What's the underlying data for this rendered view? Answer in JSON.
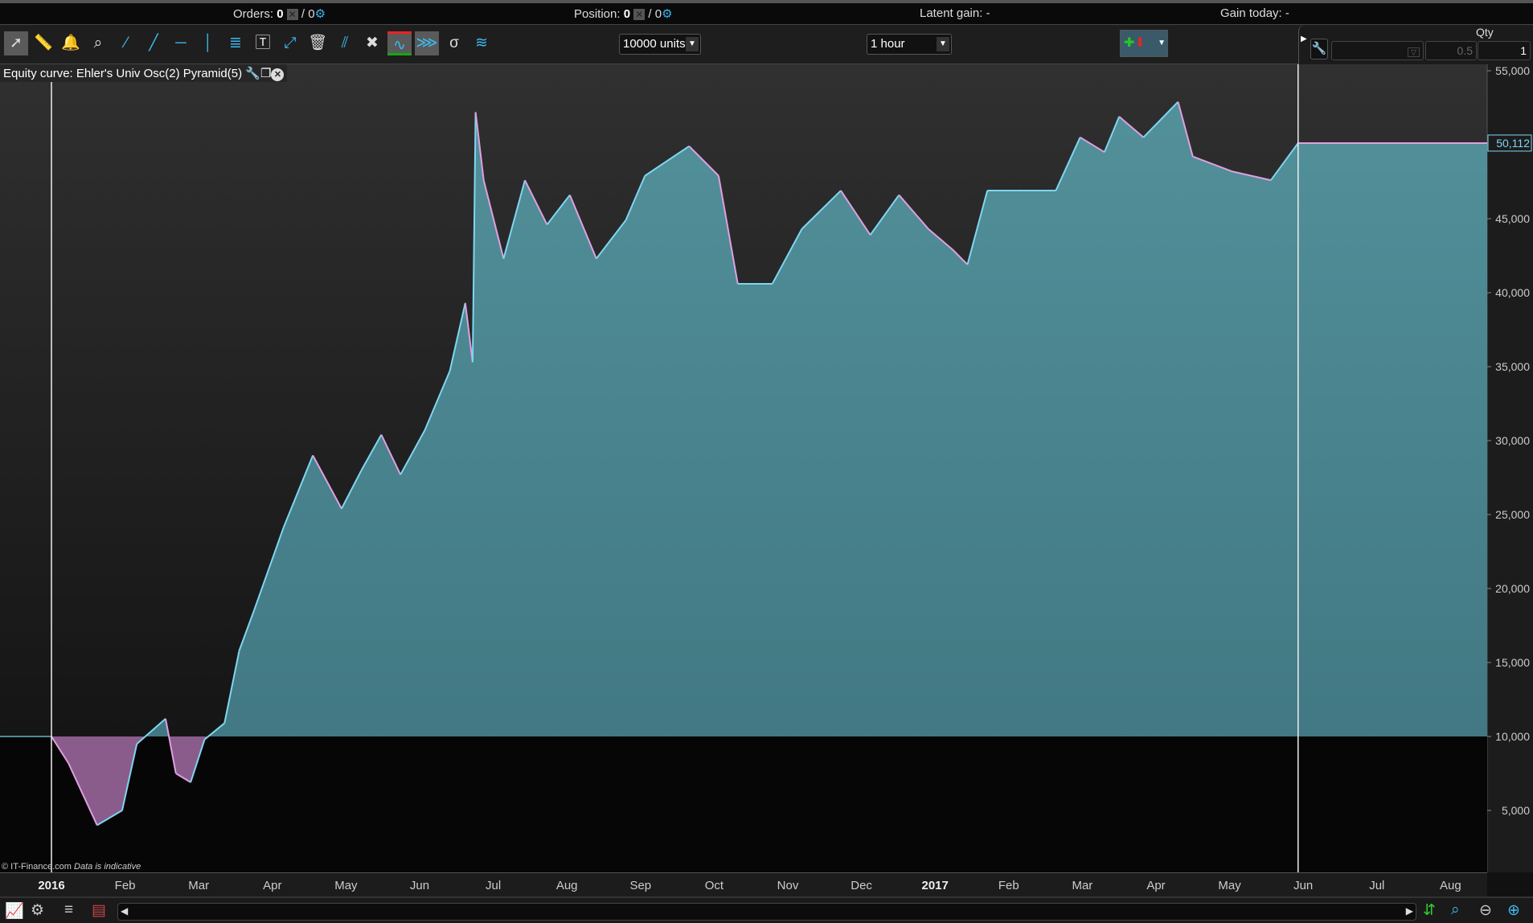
{
  "status": {
    "orders_label": "Orders:",
    "orders_value": "0",
    "orders_total": "/ 0",
    "position_label": "Position:",
    "position_value": "0",
    "position_total": "/ 0",
    "latent_gain": "Latent gain: -",
    "gain_today": "Gain today: -"
  },
  "toolbar": {
    "icons": [
      "cursor-icon",
      "ruler-icon",
      "alert-bell-icon",
      "zoom-icon",
      "segment-icon",
      "line-icon",
      "horizontal-line-icon",
      "vertical-line-icon",
      "fibonacci-icon",
      "text-icon",
      "point-icon",
      "trash-icon",
      "parallel-icon",
      "tools-icon",
      "channel-icon",
      "triangle-channel-icon",
      "std-dev-icon",
      "regression-icon"
    ],
    "units_value": "10000 units",
    "timeframe_value": "1 hour",
    "qty_label": "Qty",
    "qty_step": "0.5",
    "qty_value": "1"
  },
  "chart": {
    "legend": "Equity curve: Ehler's Univ Osc(2) Pyramid(5)",
    "copyright": "© IT-Finance.com",
    "disclaimer": "Data is indicative",
    "last_value_label": "50,112"
  },
  "colors": {
    "fill_positive": "#4d8b96",
    "fill_negative": "#8a5c8c",
    "line": "#7fd6f2",
    "line_down": "#e0a0e0",
    "background": "#2a2a2a"
  },
  "chart_data": {
    "type": "area",
    "title": "Equity curve: Ehler's Univ Osc(2) Pyramid(5)",
    "xlabel": "",
    "ylabel": "",
    "x_unit": "months since Jan 2016",
    "baseline": 10000,
    "last_value": 50112,
    "ylim": [
      1000,
      55500
    ],
    "xlim": [
      -0.7,
      19.5
    ],
    "y_ticks": [
      5000,
      10000,
      15000,
      20000,
      25000,
      30000,
      35000,
      40000,
      45000,
      50000,
      55000
    ],
    "y_tick_labels": [
      "5,000",
      "10,000",
      "15,000",
      "20,000",
      "25,000",
      "30,000",
      "35,000",
      "40,000",
      "45,000",
      "50,000",
      "55,000"
    ],
    "x_ticks": [
      0,
      1,
      2,
      3,
      4,
      5,
      6,
      7,
      8,
      9,
      10,
      11,
      12,
      13,
      14,
      15,
      16,
      17,
      18,
      19
    ],
    "x_tick_labels": [
      "2016",
      "Feb",
      "Mar",
      "Apr",
      "May",
      "Jun",
      "Jul",
      "Aug",
      "Sep",
      "Oct",
      "Nov",
      "Dec",
      "2017",
      "Feb",
      "Mar",
      "Apr",
      "May",
      "Jun",
      "Jul",
      "Aug"
    ],
    "points": [
      [
        0,
        10000
      ],
      [
        0.23,
        8200
      ],
      [
        0.62,
        4000
      ],
      [
        0.96,
        5000
      ],
      [
        1.16,
        9500
      ],
      [
        1.55,
        11200
      ],
      [
        1.69,
        7500
      ],
      [
        1.89,
        6900
      ],
      [
        2.08,
        9800
      ],
      [
        2.35,
        10900
      ],
      [
        2.55,
        15800
      ],
      [
        2.75,
        18500
      ],
      [
        3.15,
        24100
      ],
      [
        3.55,
        29000
      ],
      [
        3.94,
        25400
      ],
      [
        4.21,
        28000
      ],
      [
        4.48,
        30400
      ],
      [
        4.74,
        27700
      ],
      [
        5.07,
        30700
      ],
      [
        5.41,
        34700
      ],
      [
        5.62,
        39300
      ],
      [
        5.72,
        35300
      ],
      [
        5.76,
        52200
      ],
      [
        5.87,
        47600
      ],
      [
        6.14,
        42300
      ],
      [
        6.43,
        47600
      ],
      [
        6.73,
        44600
      ],
      [
        7.04,
        46600
      ],
      [
        7.4,
        42300
      ],
      [
        7.8,
        44900
      ],
      [
        8.06,
        47900
      ],
      [
        8.66,
        49900
      ],
      [
        9.06,
        47900
      ],
      [
        9.32,
        40600
      ],
      [
        9.79,
        40600
      ],
      [
        10.19,
        44300
      ],
      [
        10.72,
        46900
      ],
      [
        11.12,
        43900
      ],
      [
        11.51,
        46600
      ],
      [
        11.91,
        44300
      ],
      [
        12.24,
        42900
      ],
      [
        12.44,
        41900
      ],
      [
        12.71,
        46900
      ],
      [
        13.11,
        46900
      ],
      [
        13.64,
        46900
      ],
      [
        13.97,
        50500
      ],
      [
        14.3,
        49500
      ],
      [
        14.5,
        51900
      ],
      [
        14.83,
        50500
      ],
      [
        15.3,
        52900
      ],
      [
        15.5,
        49200
      ],
      [
        16.03,
        48200
      ],
      [
        16.56,
        47600
      ],
      [
        16.93,
        50112
      ]
    ]
  }
}
